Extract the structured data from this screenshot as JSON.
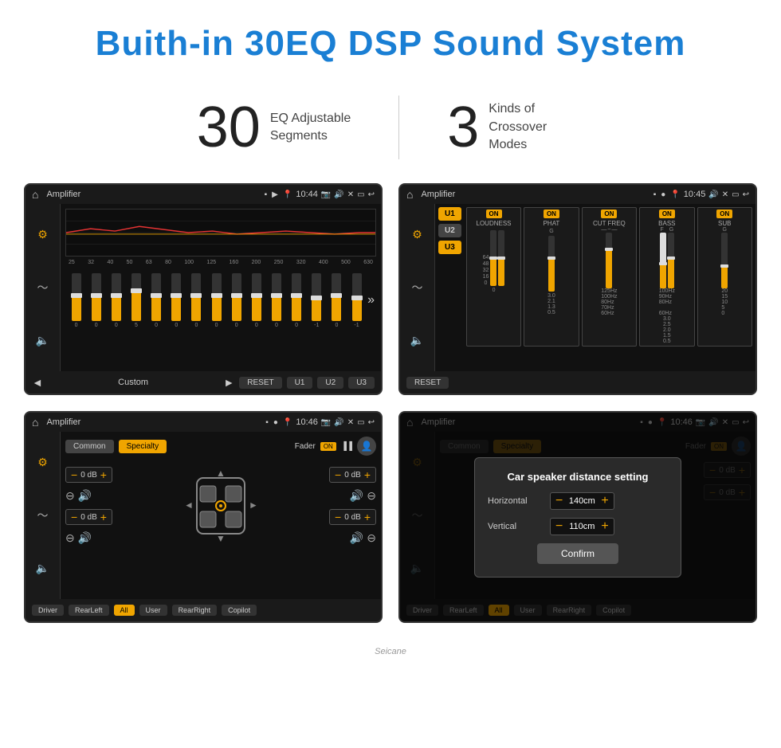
{
  "header": {
    "title": "Buith-in 30EQ DSP Sound System"
  },
  "stats": [
    {
      "number": "30",
      "label": "EQ Adjustable\nSegments"
    },
    {
      "number": "3",
      "label": "Kinds of\nCrossover Modes"
    }
  ],
  "screens": {
    "top_left": {
      "status_bar": {
        "title": "Amplifier",
        "time": "10:44"
      },
      "eq_bands": [
        {
          "freq": "25",
          "val": "0",
          "height_pct": 50
        },
        {
          "freq": "32",
          "val": "0",
          "height_pct": 50
        },
        {
          "freq": "40",
          "val": "0",
          "height_pct": 50
        },
        {
          "freq": "50",
          "val": "5",
          "height_pct": 60
        },
        {
          "freq": "63",
          "val": "0",
          "height_pct": 50
        },
        {
          "freq": "80",
          "val": "0",
          "height_pct": 50
        },
        {
          "freq": "100",
          "val": "0",
          "height_pct": 50
        },
        {
          "freq": "125",
          "val": "0",
          "height_pct": 50
        },
        {
          "freq": "160",
          "val": "0",
          "height_pct": 50
        },
        {
          "freq": "200",
          "val": "0",
          "height_pct": 50
        },
        {
          "freq": "250",
          "val": "0",
          "height_pct": 50
        },
        {
          "freq": "320",
          "val": "0",
          "height_pct": 50
        },
        {
          "freq": "400",
          "val": "-1",
          "height_pct": 45
        },
        {
          "freq": "500",
          "val": "0",
          "height_pct": 50
        },
        {
          "freq": "630",
          "val": "-1",
          "height_pct": 45
        }
      ],
      "footer": {
        "preset_label": "Custom",
        "reset_label": "RESET",
        "u1_label": "U1",
        "u2_label": "U2",
        "u3_label": "U3"
      }
    },
    "top_right": {
      "status_bar": {
        "title": "Amplifier",
        "time": "10:45"
      },
      "preset": "U3",
      "channels": [
        {
          "name": "LOUDNESS",
          "on": true
        },
        {
          "name": "PHAT",
          "on": true
        },
        {
          "name": "CUT FREQ",
          "on": true
        },
        {
          "name": "BASS",
          "on": true
        },
        {
          "name": "SUB",
          "on": true
        }
      ],
      "reset_label": "RESET"
    },
    "bottom_left": {
      "status_bar": {
        "title": "Amplifier",
        "time": "10:46"
      },
      "modes": [
        "Common",
        "Specialty"
      ],
      "active_mode": "Specialty",
      "fader_label": "Fader",
      "fader_on": "ON",
      "controls": {
        "top_left_db": "0 dB",
        "top_right_db": "0 dB",
        "bottom_left_db": "0 dB",
        "bottom_right_db": "0 dB"
      },
      "footer_buttons": [
        "Driver",
        "RearLeft",
        "All",
        "User",
        "RearRight",
        "Copilot"
      ]
    },
    "bottom_right": {
      "status_bar": {
        "title": "Amplifier",
        "time": "10:46"
      },
      "modes": [
        "Common",
        "Specialty"
      ],
      "dialog": {
        "title": "Car speaker distance setting",
        "horizontal_label": "Horizontal",
        "horizontal_value": "140cm",
        "vertical_label": "Vertical",
        "vertical_value": "110cm",
        "confirm_label": "Confirm"
      },
      "controls": {
        "top_right_db": "0 dB",
        "bottom_right_db": "0 dB"
      },
      "footer_buttons": [
        "Driver",
        "RearLeft",
        "All",
        "User",
        "RearRight",
        "Copilot"
      ]
    }
  },
  "watermark": "Seicane"
}
